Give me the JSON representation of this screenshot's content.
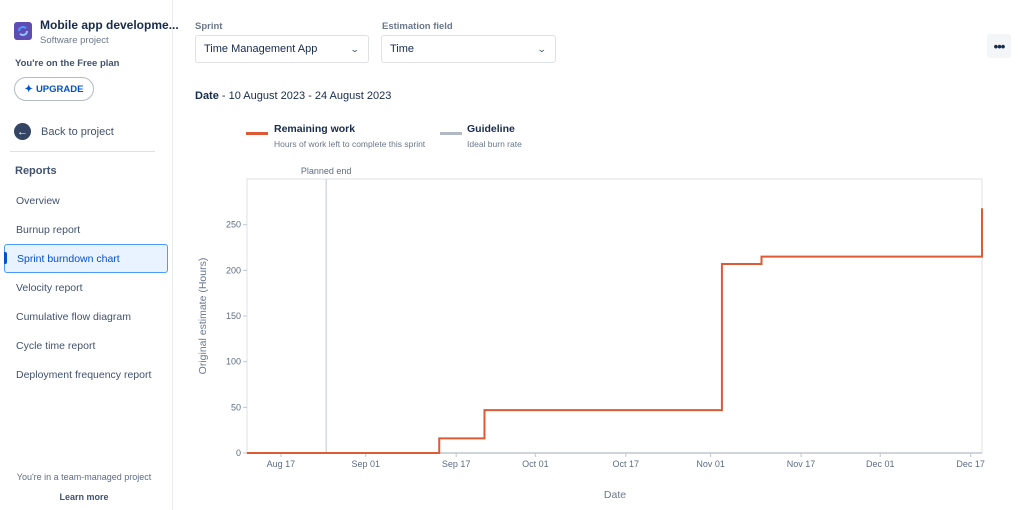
{
  "sidebar": {
    "project_name": "Mobile app developme...",
    "project_type": "Software project",
    "plan_text": "You're on the Free plan",
    "upgrade_label": "UPGRADE",
    "back_label": "Back to project",
    "reports_heading": "Reports",
    "items": [
      {
        "label": "Overview",
        "active": false
      },
      {
        "label": "Burnup report",
        "active": false
      },
      {
        "label": "Sprint burndown chart",
        "active": true
      },
      {
        "label": "Velocity report",
        "active": false
      },
      {
        "label": "Cumulative flow diagram",
        "active": false
      },
      {
        "label": "Cycle time report",
        "active": false
      },
      {
        "label": "Deployment frequency report",
        "active": false
      }
    ],
    "team_text": "You're in a team-managed project",
    "learn_more": "Learn more"
  },
  "filters": {
    "sprint_label": "Sprint",
    "sprint_value": "Time Management App",
    "estimation_label": "Estimation field",
    "estimation_value": "Time",
    "more_icon": "more-horizontal-icon"
  },
  "date_range": {
    "label": "Date",
    "value": " - 10 August 2023 - 24 August 2023"
  },
  "legend": [
    {
      "title": "Remaining work",
      "subtitle": "Hours of work left to complete this sprint",
      "color": "#de5a34"
    },
    {
      "title": "Guideline",
      "subtitle": "Ideal burn rate",
      "color": "#b3b9c4"
    }
  ],
  "colors": {
    "remaining": "#de5a34",
    "guideline": "#b3b9c4",
    "accent": "#0052cc"
  },
  "chart_data": {
    "type": "line",
    "title": "Sprint burndown chart",
    "xlabel": "Date",
    "ylabel": "Original estimate (Hours)",
    "ylim": [
      0,
      300
    ],
    "yticks": [
      0,
      50,
      100,
      150,
      200,
      250
    ],
    "xlim": [
      "2023-08-11",
      "2023-12-19"
    ],
    "xticks": [
      {
        "date": "2023-08-17",
        "label": "Aug 17"
      },
      {
        "date": "2023-09-01",
        "label": "Sep 01"
      },
      {
        "date": "2023-09-17",
        "label": "Sep 17"
      },
      {
        "date": "2023-10-01",
        "label": "Oct 01"
      },
      {
        "date": "2023-10-17",
        "label": "Oct 17"
      },
      {
        "date": "2023-11-01",
        "label": "Nov 01"
      },
      {
        "date": "2023-11-17",
        "label": "Nov 17"
      },
      {
        "date": "2023-12-01",
        "label": "Dec 01"
      },
      {
        "date": "2023-12-17",
        "label": "Dec 17"
      }
    ],
    "annotations": [
      {
        "type": "vline",
        "date": "2023-08-25",
        "label": "Planned end"
      }
    ],
    "grid": false,
    "legend_position": "top-left",
    "series": [
      {
        "name": "Remaining work",
        "step": true,
        "points": [
          {
            "x": "2023-08-11",
            "y": 0
          },
          {
            "x": "2023-09-14",
            "y": 16
          },
          {
            "x": "2023-09-22",
            "y": 47
          },
          {
            "x": "2023-11-03",
            "y": 207
          },
          {
            "x": "2023-11-10",
            "y": 215
          },
          {
            "x": "2023-12-19",
            "y": 268
          }
        ]
      },
      {
        "name": "Guideline",
        "points": []
      }
    ]
  }
}
